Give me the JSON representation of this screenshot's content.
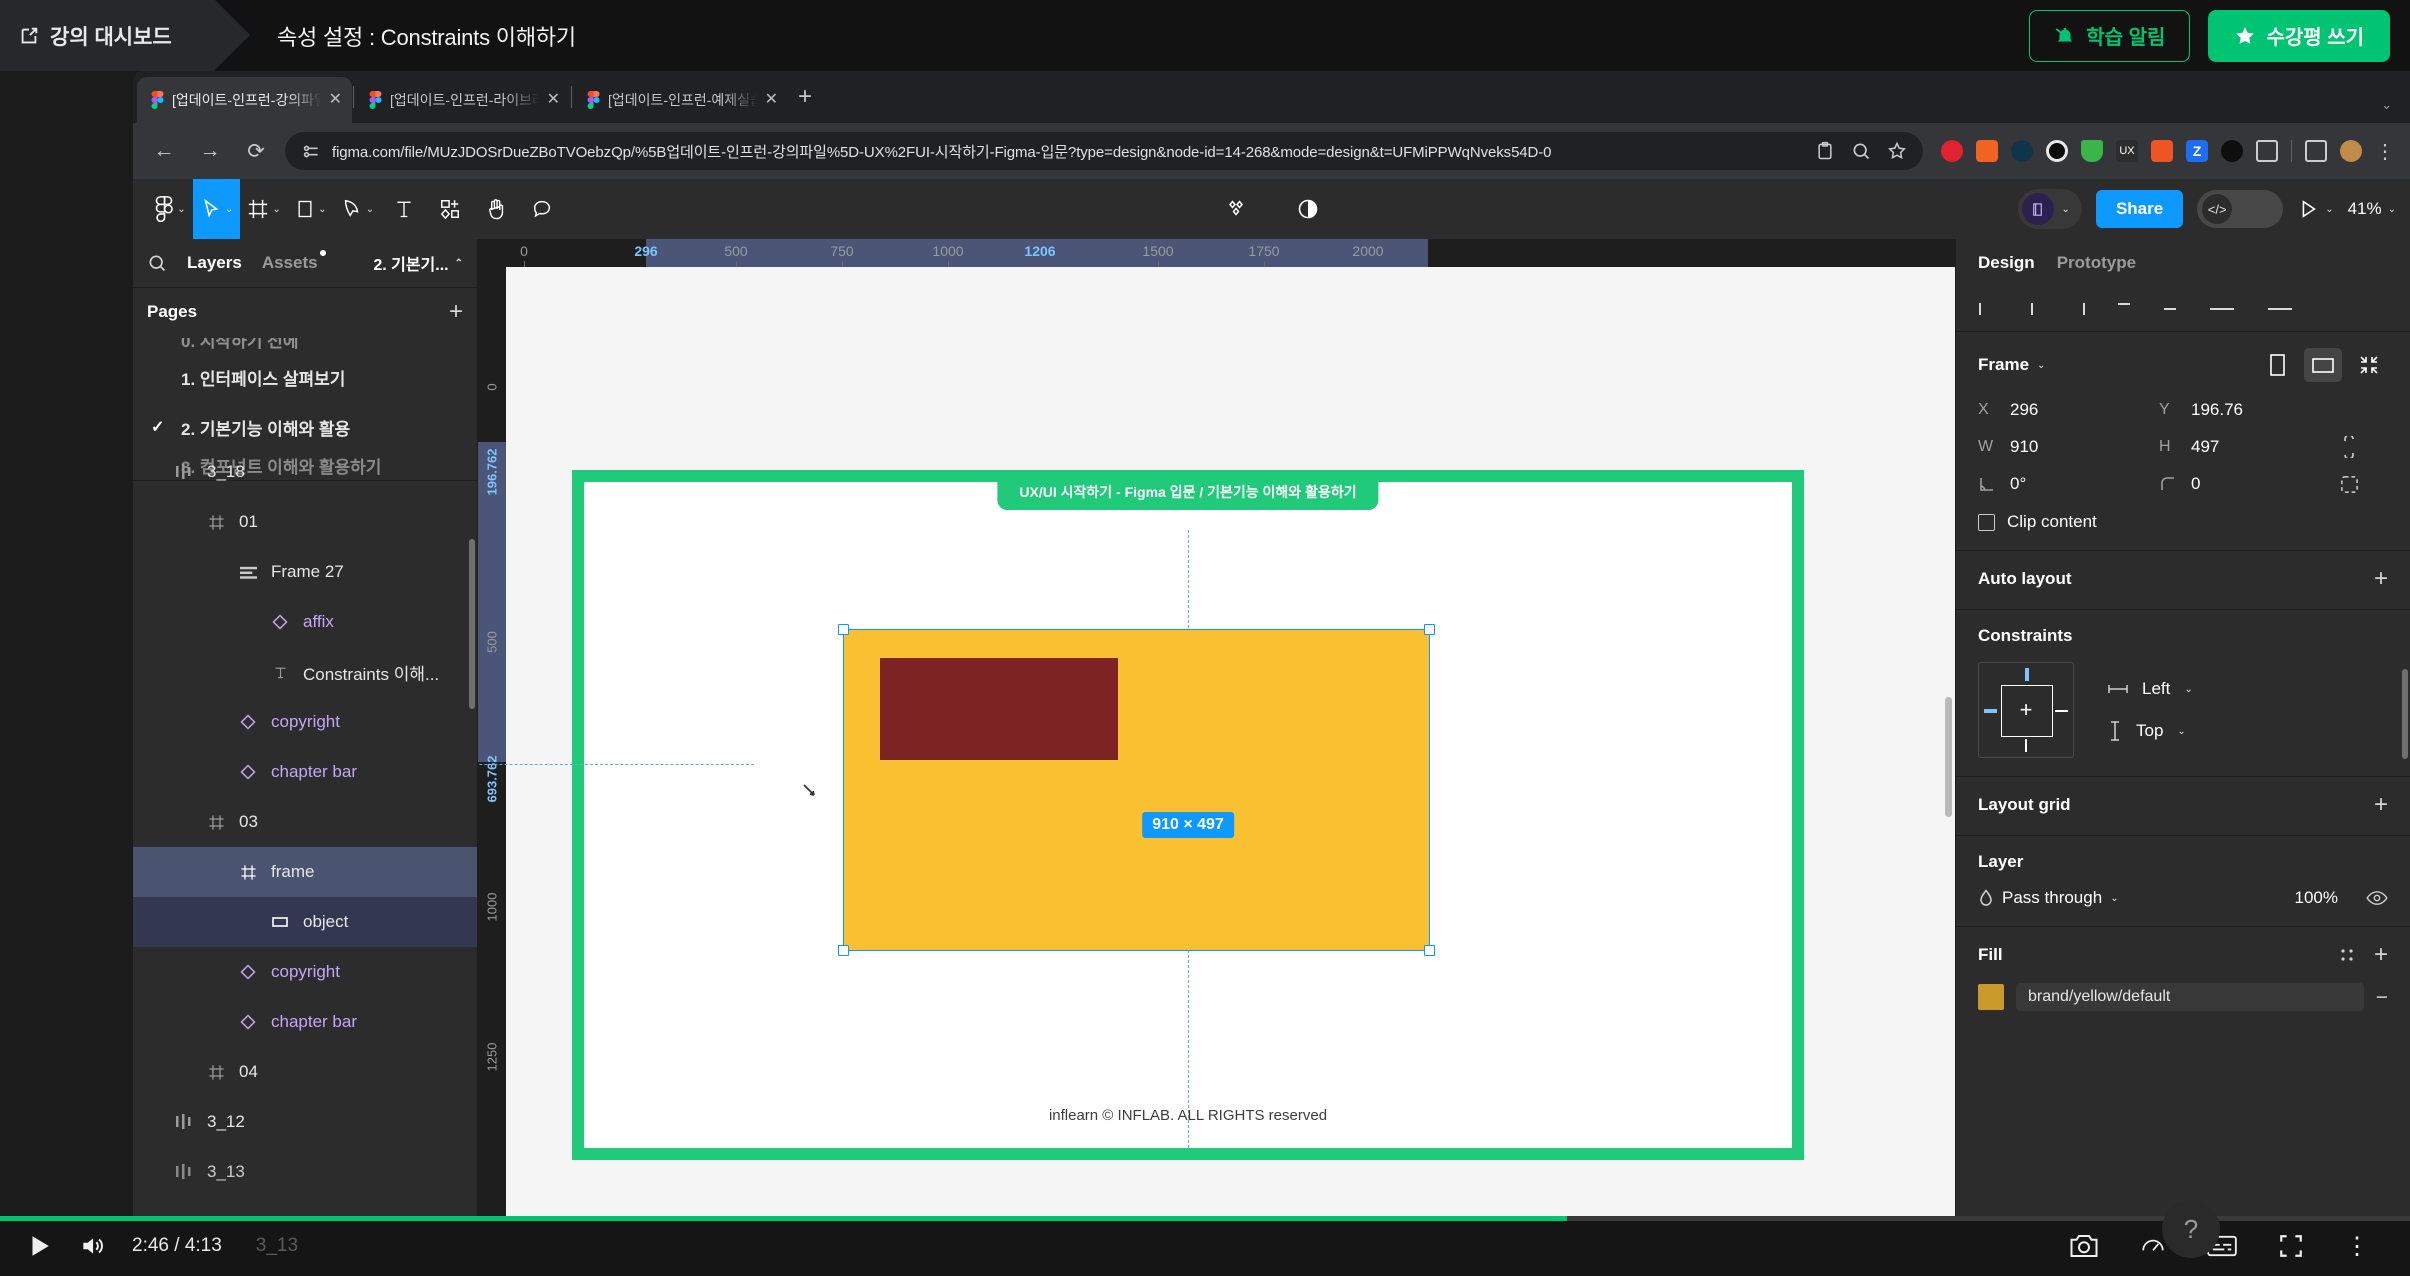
{
  "inflearn": {
    "dashboard_label": "강의 대시보드",
    "lesson_title": "속성 설정 : Constraints 이해하기",
    "notify_button": "학습 알림",
    "review_button": "수강평 쓰기",
    "accent_green": "#00c471"
  },
  "browser": {
    "tabs": [
      {
        "label": "[업데이트-인프런-강의파일] UX/U",
        "active": true
      },
      {
        "label": "[업데이트-인프런-라이브러리] UX",
        "active": false
      },
      {
        "label": "[업데이트-인프런-예제실습파일] U",
        "active": false
      }
    ],
    "new_tab_glyph": "+",
    "url": "figma.com/file/MUzJDOSrDueZBoTVOebzQp/%5B업데이트-인프런-강의파일%5D-UX%2FUI-시작하기-Figma-입문?type=design&node-id=14-268&mode=design&t=UFMiPPWqNveks54D-0"
  },
  "figma": {
    "toolbar": {
      "zoom_level": "41%",
      "share_label": "Share"
    },
    "left_panel": {
      "tab_layers": "Layers",
      "tab_assets": "Assets",
      "page_selector": "2. 기본기...",
      "pages_header": "Pages",
      "pages": [
        {
          "label": "1. 인터페이스 살펴보기",
          "checked": false
        },
        {
          "label": "2. 기본기능 이해와 활용",
          "checked": true
        },
        {
          "label": "3. 컴포넌트 이해와 활용하기",
          "checked": false
        }
      ],
      "layers": [
        {
          "label": "3_18",
          "icon": "section-icon",
          "indent": 0,
          "state": "none",
          "type": "plain"
        },
        {
          "label": "01",
          "icon": "frame-icon",
          "indent": 1,
          "state": "none",
          "type": "plain"
        },
        {
          "label": "Frame 27",
          "icon": "autolayout-icon",
          "indent": 2,
          "state": "none",
          "type": "plain"
        },
        {
          "label": "affix",
          "icon": "component-icon",
          "indent": 3,
          "state": "none",
          "type": "component"
        },
        {
          "label": "Constraints 이해...",
          "icon": "text-icon",
          "indent": 3,
          "state": "none",
          "type": "plain"
        },
        {
          "label": "copyright",
          "icon": "component-icon",
          "indent": 2,
          "state": "none",
          "type": "component"
        },
        {
          "label": "chapter bar",
          "icon": "component-icon",
          "indent": 2,
          "state": "none",
          "type": "component"
        },
        {
          "label": "03",
          "icon": "frame-icon",
          "indent": 1,
          "state": "none",
          "type": "plain"
        },
        {
          "label": "frame",
          "icon": "frame-icon",
          "indent": 2,
          "state": "parent",
          "type": "plain"
        },
        {
          "label": "object",
          "icon": "rect-icon",
          "indent": 3,
          "state": "selected",
          "type": "plain"
        },
        {
          "label": "copyright",
          "icon": "component-icon",
          "indent": 2,
          "state": "none",
          "type": "component"
        },
        {
          "label": "chapter bar",
          "icon": "component-icon",
          "indent": 2,
          "state": "none",
          "type": "component"
        },
        {
          "label": "04",
          "icon": "frame-icon",
          "indent": 1,
          "state": "none",
          "type": "plain"
        },
        {
          "label": "3_12",
          "icon": "section-icon",
          "indent": 0,
          "state": "none",
          "type": "plain"
        },
        {
          "label": "3_13",
          "icon": "section-icon",
          "indent": 0,
          "state": "none",
          "type": "plain"
        }
      ]
    },
    "canvas": {
      "ruler_h_ticks": [
        "0",
        "296",
        "500",
        "750",
        "1000",
        "1206",
        "1500",
        "1750",
        "2000"
      ],
      "ruler_h_highlight_start": "296",
      "ruler_h_highlight_end": "1206",
      "ruler_v_ticks": [
        "0",
        "196.762",
        "500",
        "693.762",
        "1000",
        "1250"
      ],
      "artboard_tab_label": "UX/UI 시작하기 - Figma 입문  /  기본기능 이해와 활용하기",
      "size_badge": "910 × 497",
      "footer_credit": "inflearn © INFLAB. ALL RIGHTS reserved",
      "frame_fill_color": "#f9c132",
      "object_fill_color": "#7d2323",
      "artboard_border_color": "#21c97a",
      "selection_color": "#0d99ff"
    },
    "right_panel": {
      "tab_design": "Design",
      "tab_prototype": "Prototype",
      "frame_label": "Frame",
      "x_key": "X",
      "x_value": "296",
      "y_key": "Y",
      "y_value": "196.76",
      "w_key": "W",
      "w_value": "910",
      "h_key": "H",
      "h_value": "497",
      "rotation_value": "0°",
      "corner_value": "0",
      "clip_content_label": "Clip content",
      "auto_layout_label": "Auto layout",
      "constraints_label": "Constraints",
      "constraint_horizontal": "Left",
      "constraint_vertical": "Top",
      "layout_grid_label": "Layout grid",
      "layer_label": "Layer",
      "blend_mode": "Pass through",
      "opacity": "100%",
      "fill_label": "Fill",
      "fill_style_name": "brand/yellow/default",
      "fill_swatch_color": "#c99a2a"
    }
  },
  "player": {
    "current_time": "2:46",
    "total_time": "4:13",
    "time_display": "2:46 / 4:13",
    "video_title": "3_13",
    "progress_percent": 65
  }
}
